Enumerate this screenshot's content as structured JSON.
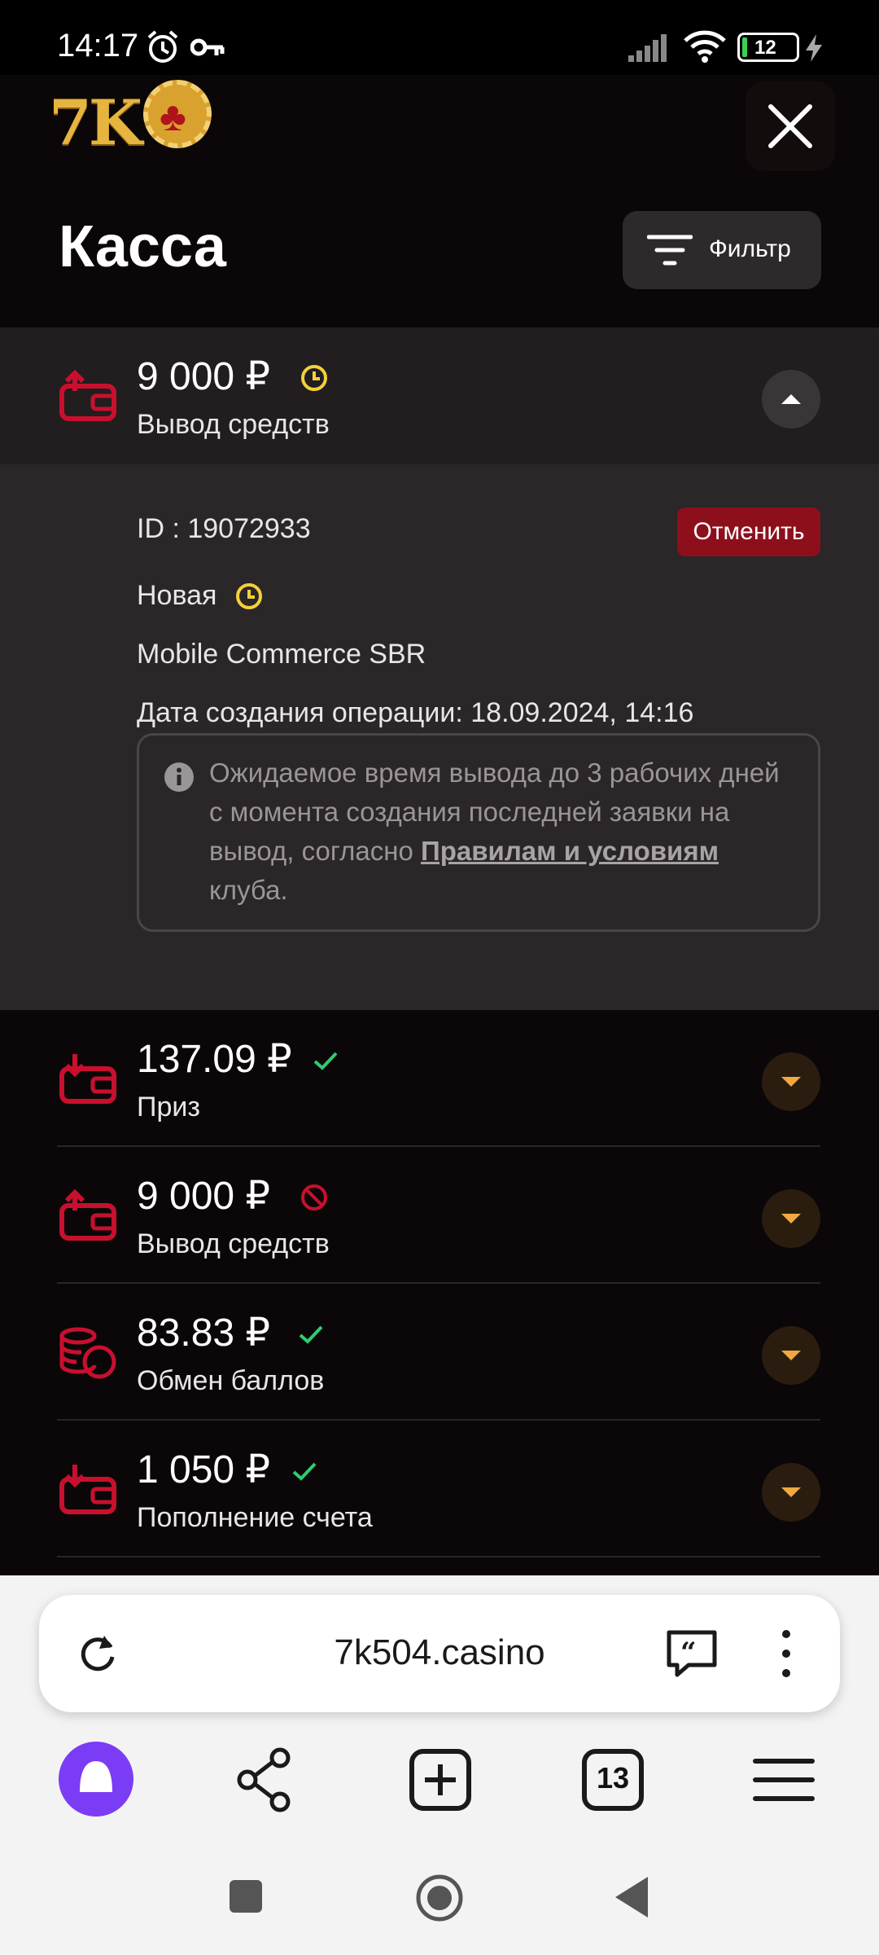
{
  "status_bar": {
    "time": "14:17",
    "battery": "12"
  },
  "header": {
    "logo_text": "7K",
    "close_icon": "close-icon",
    "title": "Касса",
    "filter_label": "Фильтр"
  },
  "expanded": {
    "amount": "9 000 ₽",
    "type": "Вывод средств",
    "status_icon": "clock-icon",
    "id_text": "ID : 19072933",
    "cancel_label": "Отменить",
    "status_text": "Новая",
    "method": "Mobile Commerce SBR",
    "date_text": "Дата создания операции: 18.09.2024, 14:16",
    "info_pre": "Ожидаемое время вывода до 3 рабочих дней с момента создания последней заявки на вывод, согласно ",
    "info_link": "Правилам и условиям",
    "info_post": " клуба."
  },
  "transactions": [
    {
      "amount": "137.09 ₽",
      "type": "Приз",
      "status": "success",
      "icon": "wallet-in-icon"
    },
    {
      "amount": "9 000 ₽",
      "type": "Вывод средств",
      "status": "cancelled",
      "icon": "wallet-out-icon"
    },
    {
      "amount": "83.83 ₽",
      "type": "Обмен баллов",
      "status": "success",
      "icon": "coins-icon"
    },
    {
      "amount": "1 050 ₽",
      "type": "Пополнение счета",
      "status": "success",
      "icon": "wallet-in-icon"
    }
  ],
  "browser": {
    "url": "7k504.casino",
    "tabs_count": "13"
  },
  "colors": {
    "accent_red": "#c8102e",
    "gold": "#e6b540",
    "success": "#2ecc71",
    "pending": "#f2d13a",
    "cancel_bg": "#8e0f1c"
  }
}
